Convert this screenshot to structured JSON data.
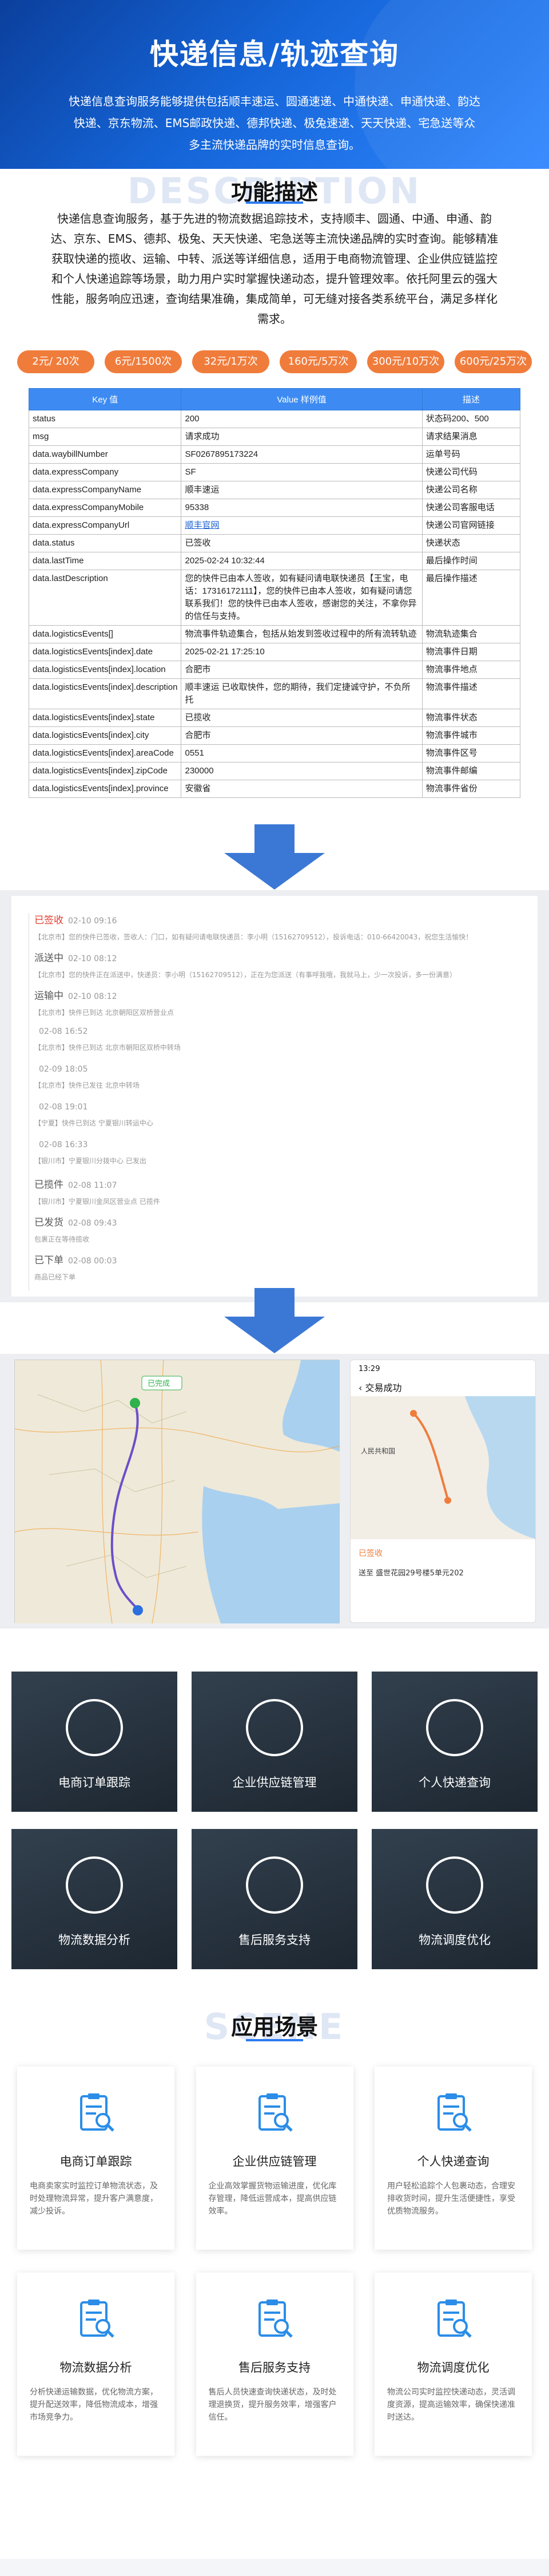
{
  "hero": {
    "title": "快递信息/轨迹查询",
    "desc": "快递信息查询服务能够提供包括顺丰速运、圆通速递、中通快递、申通快递、韵达快递、京东物流、EMS邮政快递、德邦快递、极兔速递、天天快递、宅急送等众多主流快递品牌的实时信息查询。"
  },
  "feature": {
    "ghost": "DESCRIPTION",
    "title": "功能描述",
    "desc": "快递信息查询服务，基于先进的物流数据追踪技术，支持顺丰、圆通、中通、申通、韵达、京东、EMS、德邦、极兔、天天快递、宅急送等主流快递品牌的实时查询。能够精准获取快递的揽收、运输、中转、派送等详细信息，适用于电商物流管理、企业供应链监控和个人快递追踪等场景，助力用户实时掌握快递动态，提升管理效率。依托阿里云的强大性能，服务响应迅速，查询结果准确，集成简单，可无缝对接各类系统平台，满足多样化需求。"
  },
  "prices": [
    "2元/ 20次",
    "6元/1500次",
    "32元/1万次",
    "160元/5万次",
    "300元/10万次",
    "600元/25万次"
  ],
  "table": {
    "headers": [
      "Key 值",
      "Value 样例值",
      "描述"
    ],
    "rows": [
      [
        "status",
        "200",
        "状态码200、500"
      ],
      [
        "msg",
        "请求成功",
        "请求结果消息"
      ],
      [
        "data.waybillNumber",
        "SF0267895173224",
        "运单号码"
      ],
      [
        "data.expressCompany",
        "SF",
        "快递公司代码"
      ],
      [
        "data.expressCompanyName",
        "顺丰速运",
        "快递公司名称"
      ],
      [
        "data.expressCompanyMobile",
        "95338",
        "快递公司客服电话"
      ],
      [
        "data.expressCompanyUrl",
        "顺丰官网",
        "快递公司官网链接"
      ],
      [
        "data.status",
        "已签收",
        "快递状态"
      ],
      [
        "data.lastTime",
        "2025-02-24 10:32:44",
        "最后操作时间"
      ],
      [
        "data.lastDescription",
        "您的快件已由本人签收，如有疑问请电联快递员【王宝，电话：17316172111】，您的快件已由本人签收，如有疑问请您联系我们！您的快件已由本人签收，感谢您的关注，不拿你异的信任与支持。",
        "最后操作描述"
      ],
      [
        "data.logisticsEvents[]",
        "物流事件轨迹集合，包括从始发到签收过程中的所有流转轨迹",
        "物流轨迹集合"
      ],
      [
        "data.logisticsEvents[index].date",
        "2025-02-21 17:25:10",
        "物流事件日期"
      ],
      [
        "data.logisticsEvents[index].location",
        "合肥市",
        "物流事件地点"
      ],
      [
        "data.logisticsEvents[index].description",
        "顺丰速运 已收取快件，您的期待，我们定捷诚守护，不负所托",
        "物流事件描述"
      ],
      [
        "data.logisticsEvents[index].state",
        "已揽收",
        "物流事件状态"
      ],
      [
        "data.logisticsEvents[index].city",
        "合肥市",
        "物流事件城市"
      ],
      [
        "data.logisticsEvents[index].areaCode",
        "0551",
        "物流事件区号"
      ],
      [
        "data.logisticsEvents[index].zipCode",
        "230000",
        "物流事件邮编"
      ],
      [
        "data.logisticsEvents[index].province",
        "安徽省",
        "物流事件省份"
      ]
    ]
  },
  "track": [
    {
      "state": "已签收",
      "time": "02-10 09:16",
      "text": "【北京市】您的快件已签收，签收人：门口，如有疑问请电联快递员：李小明（15162709512），投诉电话：010-66420043，祝您生活愉快！"
    },
    {
      "state": "派送中",
      "time": "02-10 08:12",
      "text": "【北京市】您的快件正在派送中，快递员：李小明（15162709512），正在为您派送（有事呼我哦，我就马上，少一次投诉，多一份满意）"
    },
    {
      "state": "运输中",
      "time": "02-10 08:12",
      "text": "【北京市】快件已到达 北京朝阳区双桥营业点"
    },
    {
      "state": "",
      "time": "02-08 16:52",
      "text": "【北京市】快件已到达 北京市朝阳区双桥中转场"
    },
    {
      "state": "",
      "time": "02-09 18:05",
      "text": "【北京市】快件已发往 北京中转场"
    },
    {
      "state": "",
      "time": "02-08 19:01",
      "text": "【宁夏】快件已到达 宁夏银川转运中心"
    },
    {
      "state": "",
      "time": "02-08 16:33",
      "text": "【银川市】宁夏银川分拨中心 已发出"
    },
    {
      "state": "已揽件",
      "time": "02-08 11:07",
      "text": "【银川市】宁夏银川金凤区营业点 已揽件"
    },
    {
      "state": "已发货",
      "time": "02-08 09:43",
      "text": "包裹正在等待揽收"
    },
    {
      "state": "已下单",
      "time": "02-08 00:03",
      "text": "商品已经下单"
    }
  ],
  "map": {
    "badge": "已完成",
    "time": "13:29",
    "title": "交易成功",
    "place": "人民共和国",
    "status": "已签收",
    "addr": "送至 盛世花园29号楼5单元202"
  },
  "tiles": [
    "电商订单跟踪",
    "企业供应链管理",
    "个人快递查询",
    "物流数据分析",
    "售后服务支持",
    "物流调度优化"
  ],
  "scenes": {
    "ghost": "SCENE",
    "title": "应用场景",
    "items": [
      {
        "title": "电商订单跟踪",
        "desc": "电商卖家实时监控订单物流状态，及时处理物流异常，提升客户满意度，减少投诉。"
      },
      {
        "title": "企业供应链管理",
        "desc": "企业高效掌握货物运输进度，优化库存管理，降低运营成本，提高供应链效率。"
      },
      {
        "title": "个人快递查询",
        "desc": "用户轻松追踪个人包裹动态，合理安排收货时间，提升生活便捷性，享受优质物流服务。"
      },
      {
        "title": "物流数据分析",
        "desc": "分析快递运输数据，优化物流方案，提升配送效率，降低物流成本，增强市场竞争力。"
      },
      {
        "title": "售后服务支持",
        "desc": "售后人员快速查询快递状态，及时处理退换货，提升服务效率，增强客户信任。"
      },
      {
        "title": "物流调度优化",
        "desc": "物流公司实时监控快递动态，灵活调度资源，提高运输效率，确保快递准时送达。"
      }
    ]
  }
}
